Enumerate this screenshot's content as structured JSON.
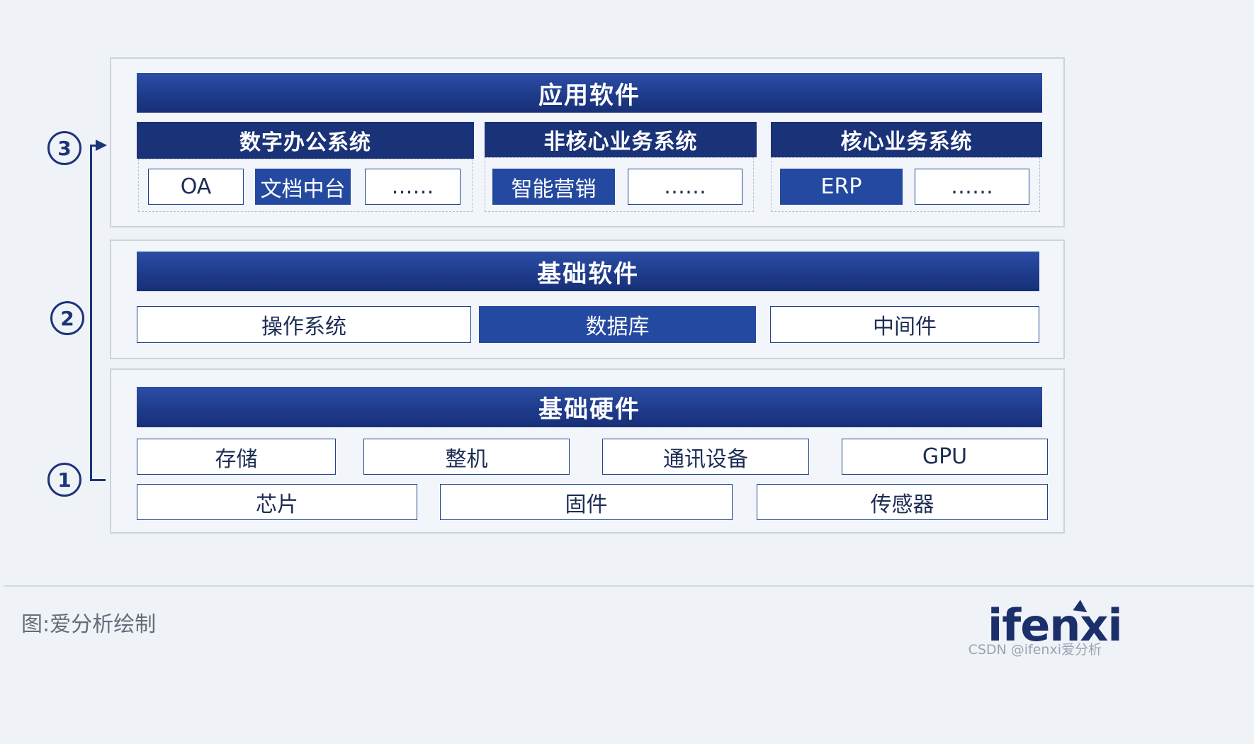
{
  "app_layer": {
    "title": "应用软件",
    "groups": [
      {
        "title": "数字办公系统",
        "items": [
          "OA",
          "文档中台",
          "……"
        ]
      },
      {
        "title": "非核心业务系统",
        "items": [
          "智能营销",
          "……"
        ]
      },
      {
        "title": "核心业务系统",
        "items": [
          "ERP",
          "……"
        ]
      }
    ]
  },
  "base_software": {
    "title": "基础软件",
    "items": [
      "操作系统",
      "数据库",
      "中间件"
    ]
  },
  "base_hardware": {
    "title": "基础硬件",
    "row1": [
      "存储",
      "整机",
      "通讯设备",
      "GPU"
    ],
    "row2": [
      "芯片",
      "固件",
      "传感器"
    ]
  },
  "steps": [
    "1",
    "2",
    "3"
  ],
  "footer": {
    "caption": "图:爱分析绘制",
    "logo": "ifenxi",
    "watermark": "CSDN @ifenxi爱分析"
  },
  "colors": {
    "primary_dark": "#1a3278",
    "primary": "#2449a0",
    "background": "#eff3f8"
  }
}
